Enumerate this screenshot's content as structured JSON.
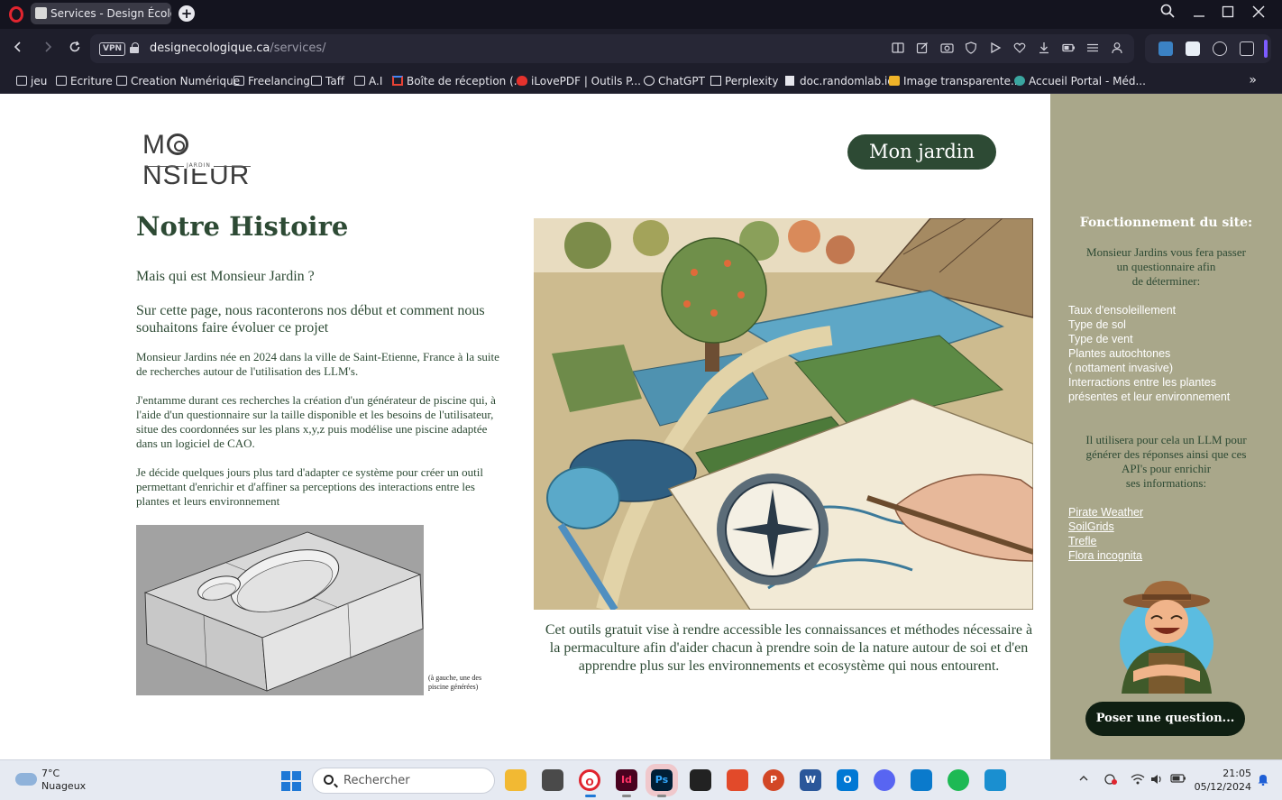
{
  "browser": {
    "tab_title": "Services - Design Écologique",
    "new_tab_label": "+",
    "vpn_label": "VPN",
    "url_domain": "designecologique.ca",
    "url_path": "/services/",
    "bookmarks": [
      {
        "label": "jeu",
        "icon": "folder-icon"
      },
      {
        "label": "Ecriture",
        "icon": "folder-icon"
      },
      {
        "label": "Creation Numérique",
        "icon": "folder-icon"
      },
      {
        "label": "Freelancing",
        "icon": "folder-icon"
      },
      {
        "label": "Taff",
        "icon": "folder-icon"
      },
      {
        "label": "A.I",
        "icon": "folder-icon"
      },
      {
        "label": "Boîte de réception (...",
        "icon": "gmail-icon"
      },
      {
        "label": "iLovePDF | Outils P...",
        "icon": "ilovepdf-icon"
      },
      {
        "label": "ChatGPT",
        "icon": "chatgpt-icon"
      },
      {
        "label": "Perplexity",
        "icon": "perplexity-icon"
      },
      {
        "label": "doc.randomlab.io",
        "icon": "document-icon"
      },
      {
        "label": "Image transparente...",
        "icon": "image-icon"
      },
      {
        "label": "Accueil Portal - Méd...",
        "icon": "portal-icon"
      }
    ],
    "colors": {
      "chrome_dark": "#14141f",
      "chrome": "#1e1e2b",
      "opera_red": "#e0252f"
    }
  },
  "page": {
    "logo_text_left": "M",
    "logo_text_right": "NSIEUR",
    "logo_sub": "JARDIN",
    "garden_button": "Mon jardin",
    "title": "Notre Histoire",
    "question": "Mais qui est Monsieur Jardin ?",
    "intro": "Sur cette page, nous raconterons nos début et comment nous souhaitons faire évoluer ce projet",
    "paragraphs": [
      "Monsieur Jardins née en 2024 dans la ville de Saint-Etienne, France à la suite de recherches autour de l'utilisation des LLM's.",
      "J'entamme durant ces recherches la création d'un générateur de piscine qui, à l'aide d'un questionnaire sur la taille disponible et les besoins de l'utilisateur, situe des coordonnées sur les plans x,y,z puis modélise une piscine adaptée dans un logiciel de CAO.",
      "Je décide quelques jours plus tard d'adapter ce système pour créer un outil permettant d'enrichir et d'affiner sa perceptions des interactions entre les plantes et leurs environnement"
    ],
    "cad_caption": "(à gauche, une des piscine générées)",
    "closing": "Cet outils gratuit vise à rendre accessible les connaissances et méthodes nécessaire à la permaculture afin d'aider chacun à prendre soin de la nature autour de soi et d'en apprendre plus sur les environnements et ecosystème qui nous entourent.",
    "colors": {
      "accent_green": "#2d4a34",
      "sidebar_bg": "#a9a78a"
    }
  },
  "sidebar": {
    "title": "Fonctionnement du site:",
    "intro_lines": [
      "Monsieur Jardins vous fera passer",
      "un questionnaire afin",
      "de déterminer:"
    ],
    "criteria": [
      "Taux d'ensoleillement",
      "Type de sol",
      "Type de vent",
      "Plantes autochtones",
      "( nottament invasive)",
      "Interractions entre les plantes",
      "présentes et leur environnement"
    ],
    "mid_lines": [
      "Il utilisera pour cela un LLM pour",
      "générer des réponses ainsi que ces",
      "API's pour enrichir",
      "ses informations:"
    ],
    "links": [
      "Pirate Weather",
      "SoilGrids",
      "Trefle",
      "Flora incognita"
    ],
    "ask_button": "Poser une question..."
  },
  "taskbar": {
    "temperature": "7°C",
    "weather": "Nuageux",
    "search_placeholder": "Rechercher",
    "apps": [
      {
        "name": "file-explorer",
        "label": ""
      },
      {
        "name": "3d-app",
        "label": ""
      },
      {
        "name": "opera",
        "label": "O"
      },
      {
        "name": "indesign",
        "label": "Id"
      },
      {
        "name": "photoshop",
        "label": "Ps"
      },
      {
        "name": "rhino",
        "label": ""
      },
      {
        "name": "app-red",
        "label": ""
      },
      {
        "name": "powerpoint",
        "label": "P"
      },
      {
        "name": "word",
        "label": "W"
      },
      {
        "name": "outlook",
        "label": "O"
      },
      {
        "name": "discord",
        "label": ""
      },
      {
        "name": "vscode",
        "label": ""
      },
      {
        "name": "spotify",
        "label": ""
      },
      {
        "name": "app-blue",
        "label": ""
      }
    ],
    "time": "21:05",
    "date": "05/12/2024"
  }
}
